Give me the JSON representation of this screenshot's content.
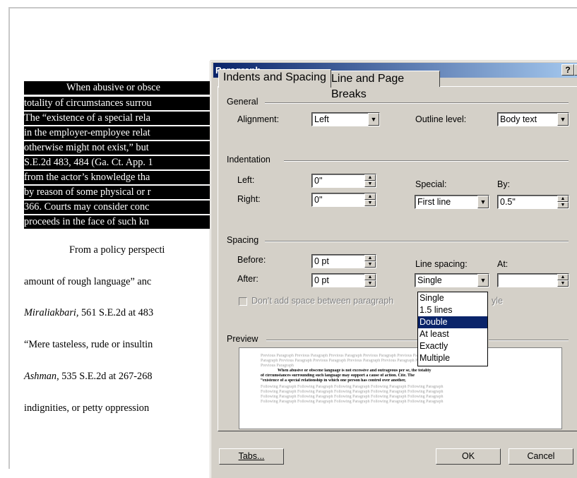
{
  "document": {
    "highlighted_lines": [
      "When abusive or obsce",
      "totality of circumstances surrou",
      "The “existence of a special rela",
      "in the employer-employee relat",
      "otherwise might not exist,” but",
      "S.E.2d 483, 484 (Ga. Ct. App. 1",
      "from the actor’s knowledge tha",
      "by reason of some physical or r",
      "366.  Courts may consider conc",
      "proceeds in the face of such kn"
    ],
    "para2_line1": "From a policy perspecti",
    "para2_line2": "amount of rough language”  anc",
    "para2_line3_italic": "Miraliakbari,",
    "para2_line3_rest": " 561 S.E.2d at 483",
    "para2_line4": "“Mere tasteless, rude or insultin",
    "para2_line5_italic": "Ashman",
    "para2_line5_rest": ", 535 S.E.2d at 267-268",
    "para2_line6": "indignities, or petty oppression"
  },
  "dialog": {
    "title": "Paragraph",
    "help_label": "?",
    "close_label": "X",
    "tabs": [
      "Indents and Spacing",
      "Line and Page Breaks"
    ],
    "general": {
      "group_label": "General",
      "alignment_label": "Alignment:",
      "alignment_value": "Left",
      "outline_label": "Outline level:",
      "outline_value": "Body text"
    },
    "indentation": {
      "group_label": "Indentation",
      "left_label": "Left:",
      "left_value": "0\"",
      "right_label": "Right:",
      "right_value": "0\"",
      "special_label": "Special:",
      "special_value": "First line",
      "by_label": "By:",
      "by_value": "0.5\""
    },
    "spacing": {
      "group_label": "Spacing",
      "before_label": "Before:",
      "before_value": "0 pt",
      "after_label": "After:",
      "after_value": "0 pt",
      "line_spacing_label": "Line spacing:",
      "line_spacing_value": "Single",
      "at_label": "At:",
      "at_value": "",
      "dont_add_label": "Don't add space between paragraph",
      "dont_add_tail": "yle",
      "dropdown_options": [
        "Single",
        "1.5 lines",
        "Double",
        "At least",
        "Exactly",
        "Multiple"
      ],
      "dropdown_selected": "Double"
    },
    "preview": {
      "group_label": "Preview",
      "prev_lines": [
        "Previous Paragraph Previous Paragraph Previous Paragraph Previous Paragraph Previous Paragraph",
        "Paragraph Previous Paragraph Previous Paragraph Previous Paragraph Previous Paragraph Previous Paragraph",
        "Previous Paragraph"
      ],
      "sample_lines": [
        "When abusive or obscene language is not excessive and outrageous per se, the totality",
        "of circumstances surrounding such language may support a cause of action.  Cite. The",
        "“existence of a special relationship in which one person has control over another,"
      ],
      "next_lines": [
        "Following Paragraph Following Paragraph Following Paragraph Following Paragraph Following Paragraph",
        "Following Paragraph Following Paragraph Following Paragraph Following Paragraph Following Paragraph",
        "Following Paragraph Following Paragraph Following Paragraph Following Paragraph Following Paragraph",
        "Following Paragraph Following Paragraph Following Paragraph Following Paragraph Following Paragraph"
      ]
    },
    "buttons": {
      "tabs_label": "Tabs...",
      "ok_label": "OK",
      "cancel_label": "Cancel"
    }
  }
}
